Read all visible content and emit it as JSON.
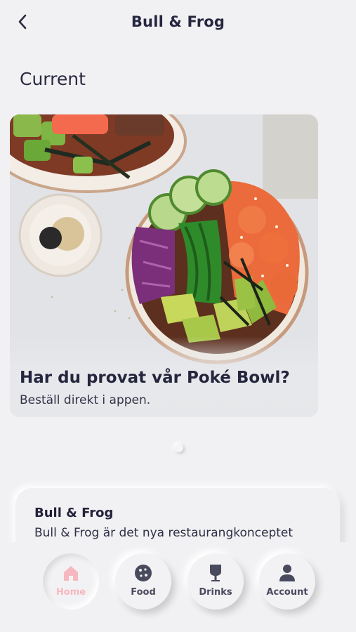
{
  "header": {
    "title": "Bull & Frog",
    "back_icon": "chevron-left-icon"
  },
  "section": {
    "title": "Current"
  },
  "promo": {
    "heading": "Har du provat vår Poké Bowl?",
    "subtitle": "Beställ direkt i appen."
  },
  "info_card": {
    "title": "Bull & Frog",
    "text": "Bull & Frog är det nya restaurangkonceptet"
  },
  "nav": {
    "items": [
      {
        "label": "Home",
        "icon": "home-icon",
        "active": true
      },
      {
        "label": "Food",
        "icon": "cookie-icon",
        "active": false
      },
      {
        "label": "Drinks",
        "icon": "glass-icon",
        "active": false
      },
      {
        "label": "Account",
        "icon": "person-icon",
        "active": false
      }
    ]
  },
  "colors": {
    "background": "#f1f1f3",
    "text": "#22223a",
    "active_nav": "#f6b8c0"
  }
}
